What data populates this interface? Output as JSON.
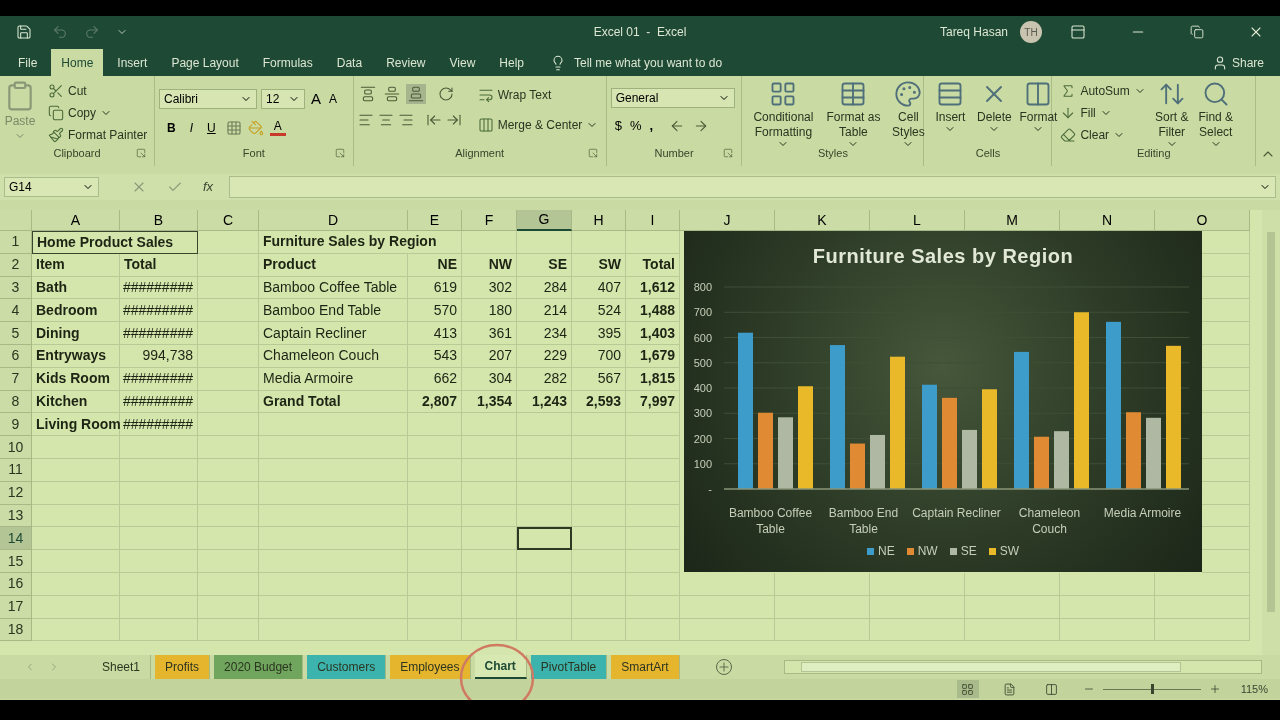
{
  "window": {
    "title": "Excel 01  -  Excel",
    "user": "Tareq Hasan",
    "avatar": "TH"
  },
  "ribbon_tabs": [
    {
      "label": "File",
      "selected": false
    },
    {
      "label": "Home",
      "selected": true
    },
    {
      "label": "Insert",
      "selected": false
    },
    {
      "label": "Page Layout",
      "selected": false
    },
    {
      "label": "Formulas",
      "selected": false
    },
    {
      "label": "Data",
      "selected": false
    },
    {
      "label": "Review",
      "selected": false
    },
    {
      "label": "View",
      "selected": false
    },
    {
      "label": "Help",
      "selected": false
    }
  ],
  "tell_me": "Tell me what you want to do",
  "share": "Share",
  "ribbon": {
    "clipboard": {
      "label": "Clipboard",
      "paste": "Paste",
      "cut": "Cut",
      "copy": "Copy",
      "format_painter": "Format Painter"
    },
    "font": {
      "label": "Font",
      "font_name": "Calibri",
      "font_size": "12",
      "grow": "A",
      "shrink": "A",
      "bold": "B",
      "italic": "I",
      "underline": "U",
      "font_color": "A"
    },
    "alignment": {
      "label": "Alignment",
      "vertical_align": [
        {
          "selected": false
        },
        {
          "selected": false
        },
        {
          "selected": true
        }
      ],
      "wrap_text": "Wrap Text",
      "merge_center": "Merge & Center"
    },
    "number": {
      "label": "Number",
      "format": "General",
      "currency": "$",
      "percent": "%",
      "comma": ","
    },
    "styles": {
      "label": "Styles",
      "buttons": [
        "Conditional Formatting",
        "Format as Table",
        "Cell Styles"
      ]
    },
    "cells": {
      "label": "Cells",
      "buttons": [
        "Insert",
        "Delete",
        "Format"
      ]
    },
    "editing": {
      "label": "Editing",
      "autosum": "AutoSum",
      "fill": "Fill",
      "clear": "Clear",
      "sort_filter": "Sort & Filter",
      "find_select": "Find & Select"
    }
  },
  "name_box": "G14",
  "fx": "fx",
  "columns": [
    {
      "label": "A",
      "selected": false
    },
    {
      "label": "B",
      "selected": false
    },
    {
      "label": "C",
      "selected": false
    },
    {
      "label": "D",
      "selected": false
    },
    {
      "label": "E",
      "selected": false
    },
    {
      "label": "F",
      "selected": false
    },
    {
      "label": "G",
      "selected": true
    },
    {
      "label": "H",
      "selected": false
    },
    {
      "label": "I",
      "selected": false
    },
    {
      "label": "J",
      "selected": false
    },
    {
      "label": "K",
      "selected": false
    },
    {
      "label": "L",
      "selected": false
    },
    {
      "label": "M",
      "selected": false
    },
    {
      "label": "N",
      "selected": false
    },
    {
      "label": "O",
      "selected": false
    }
  ],
  "rows": [
    {
      "label": "1",
      "selected": false
    },
    {
      "label": "2",
      "selected": false
    },
    {
      "label": "3",
      "selected": false
    },
    {
      "label": "4",
      "selected": false
    },
    {
      "label": "5",
      "selected": false
    },
    {
      "label": "6",
      "selected": false
    },
    {
      "label": "7",
      "selected": false
    },
    {
      "label": "8",
      "selected": false
    },
    {
      "label": "9",
      "selected": false
    },
    {
      "label": "10",
      "selected": false
    },
    {
      "label": "11",
      "selected": false
    },
    {
      "label": "12",
      "selected": false
    },
    {
      "label": "13",
      "selected": false
    },
    {
      "label": "14",
      "selected": true
    },
    {
      "label": "15",
      "selected": false
    },
    {
      "label": "16",
      "selected": false
    },
    {
      "label": "17",
      "selected": false
    },
    {
      "label": "18",
      "selected": false
    }
  ],
  "home_sales": {
    "title": "Home Product Sales",
    "headers": [
      "Item",
      "Total"
    ],
    "rows": [
      {
        "item": "Bath",
        "total": "#########"
      },
      {
        "item": "Bedroom",
        "total": "#########"
      },
      {
        "item": "Dining",
        "total": "#########"
      },
      {
        "item": "Entryways",
        "total": "994,738"
      },
      {
        "item": "Kids Room",
        "total": "#########"
      },
      {
        "item": "Kitchen",
        "total": "#########"
      },
      {
        "item": "Living Room",
        "total": "#########"
      }
    ]
  },
  "furniture": {
    "title": "Furniture Sales by Region",
    "headers": [
      "Product",
      "NE",
      "NW",
      "SE",
      "SW",
      "Total"
    ],
    "rows": [
      [
        "Bamboo Coffee Table",
        "619",
        "302",
        "284",
        "407",
        "1,612"
      ],
      [
        "Bamboo End Table",
        "570",
        "180",
        "214",
        "524",
        "1,488"
      ],
      [
        "Captain Recliner",
        "413",
        "361",
        "234",
        "395",
        "1,403"
      ],
      [
        "Chameleon Couch",
        "543",
        "207",
        "229",
        "700",
        "1,679"
      ],
      [
        "Media Armoire",
        "662",
        "304",
        "282",
        "567",
        "1,815"
      ]
    ],
    "grand_total": [
      "Grand Total",
      "2,807",
      "1,354",
      "1,243",
      "2,593",
      "7,997"
    ]
  },
  "chart": {
    "chart_data": {
      "type": "bar",
      "title": "Furniture Sales by Region",
      "categories": [
        "Bamboo Coffee Table",
        "Bamboo End Table",
        "Captain Recliner",
        "Chameleon Couch",
        "Media Armoire"
      ],
      "series": [
        {
          "name": "NE",
          "color": "#3d9cc9",
          "values": [
            619,
            570,
            413,
            543,
            662
          ]
        },
        {
          "name": "NW",
          "color": "#e08a34",
          "values": [
            302,
            180,
            361,
            207,
            304
          ]
        },
        {
          "name": "SE",
          "color": "#aeb8a2",
          "values": [
            284,
            214,
            234,
            229,
            282
          ]
        },
        {
          "name": "SW",
          "color": "#e9b92a",
          "values": [
            407,
            524,
            395,
            700,
            567
          ]
        }
      ],
      "grid": true,
      "legend": true,
      "ylim": [
        0,
        800
      ],
      "yticks": [
        {
          "value": 0,
          "label": "-"
        },
        100,
        200,
        300,
        400,
        500,
        600,
        700,
        800
      ]
    }
  },
  "sheet_tabs": [
    {
      "label": "Sheet1",
      "selected": false
    },
    {
      "label": "Profits",
      "selected": false,
      "color": "#e6b52e"
    },
    {
      "label": "2020 Budget",
      "selected": false,
      "color": "#6fa55c"
    },
    {
      "label": "Customers",
      "selected": false,
      "color": "#3db3ad"
    },
    {
      "label": "Employees",
      "selected": false,
      "color": "#e6b52e"
    },
    {
      "label": "Chart",
      "selected": true
    },
    {
      "label": "PivotTable",
      "selected": false,
      "color": "#3db3ad"
    },
    {
      "label": "SmartArt",
      "selected": false,
      "color": "#e6b52e"
    }
  ],
  "status_bar": {
    "views": [
      {
        "selected": true
      },
      {
        "selected": false
      },
      {
        "selected": false
      }
    ],
    "zoom_slider": {
      "level": 0.5
    },
    "zoom": "115%"
  }
}
